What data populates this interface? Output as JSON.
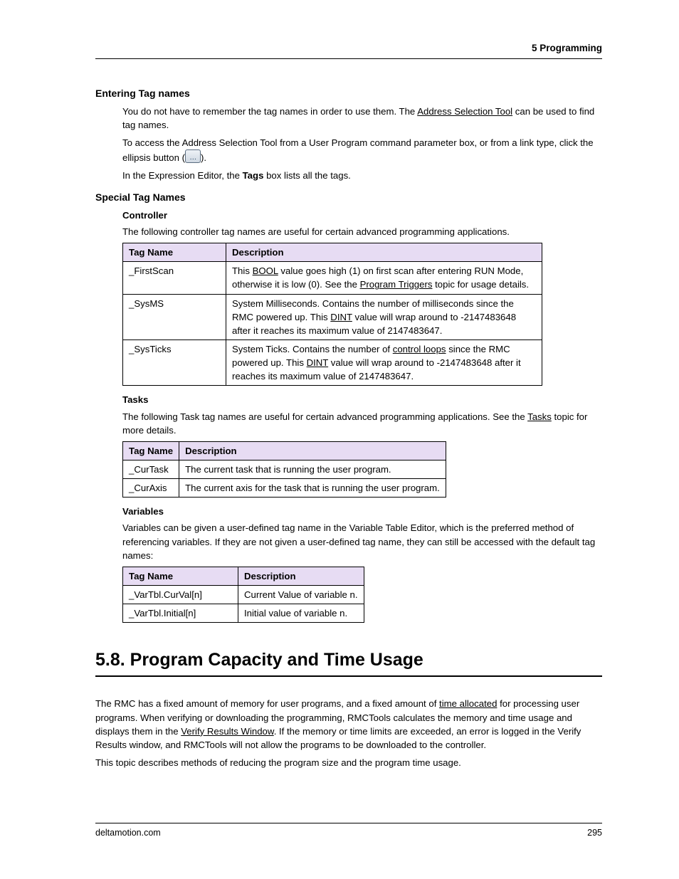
{
  "header": {
    "chapter": "5  Programming"
  },
  "s1": {
    "title": "Entering Tag names",
    "p1_a": "You do not have to remember the tag names in order to use them. The ",
    "p1_link": "Address Selection Tool",
    "p1_b": " can be used to find tag names.",
    "p2": "To access the Address Selection Tool from a User Program command parameter box, or from a link type, click the ellipsis button (",
    "p2_end": ").",
    "p3_a": "In the Expression Editor, the ",
    "p3_b": "Tags",
    "p3_c": " box lists all the tags."
  },
  "s2": {
    "title": "Special Tag Names",
    "controller": {
      "title": "Controller",
      "intro": "The following controller tag names are useful for certain advanced programming applications.",
      "th1": "Tag Name",
      "th2": "Description",
      "rows": [
        {
          "tag": "_FirstScan",
          "d1": "This ",
          "l1": "BOOL",
          "d2": " value goes high (1) on first scan after entering RUN Mode, otherwise it is low (0). See the ",
          "l2": "Program Triggers",
          "d3": " topic for usage details."
        },
        {
          "tag": "_SysMS",
          "d1": "System Milliseconds. Contains the number of milliseconds since the RMC powered up. This ",
          "l1": "DINT",
          "d2": " value will wrap around to -2147483648 after it reaches its maximum value of 2147483647.",
          "l2": "",
          "d3": ""
        },
        {
          "tag": "_SysTicks",
          "d1": "System Ticks. Contains the number of ",
          "l1": "control loops",
          "d2": " since the RMC powered up. This ",
          "l2": "DINT",
          "d3": " value will wrap around to -2147483648 after it reaches its maximum value of 2147483647."
        }
      ]
    },
    "tasks": {
      "title": "Tasks",
      "intro_a": "The following Task tag names are useful for certain advanced programming applications. See the ",
      "intro_link": "Tasks",
      "intro_b": " topic for more details.",
      "th1": "Tag Name",
      "th2": "Description",
      "rows": [
        {
          "tag": "_CurTask",
          "desc": "The current task that is running the user program."
        },
        {
          "tag": "_CurAxis",
          "desc": "The current axis for the task that is running the user program."
        }
      ]
    },
    "vars": {
      "title": "Variables",
      "intro": "Variables can be given a user-defined tag name in the Variable Table Editor, which is the preferred method of referencing variables. If they are not given a user-defined tag name, they can still be accessed with the default tag names:",
      "th1": "Tag Name",
      "th2": "Description",
      "rows": [
        {
          "tag": "_VarTbl.CurVal[n]",
          "desc": "Current Value of variable n."
        },
        {
          "tag": "_VarTbl.Initial[n]",
          "desc": "Initial value of variable n."
        }
      ]
    }
  },
  "s58": {
    "title": "5.8. Program Capacity and Time Usage",
    "p1_a": "The RMC has a fixed amount of memory for user programs, and a fixed amount of ",
    "l1": "time allocated",
    "p1_b": " for processing user programs. When verifying or downloading the programming, RMCTools calculates the memory and time usage and displays them in the ",
    "l2": "Verify Results Window",
    "p1_c": ". If the memory or time limits are exceeded, an error is logged in the Verify Results window, and RMCTools will not allow the programs to be downloaded to the controller.",
    "p2": "This topic describes methods of reducing the program size and the program time usage."
  },
  "footer": {
    "site": "deltamotion.com",
    "page": "295"
  }
}
